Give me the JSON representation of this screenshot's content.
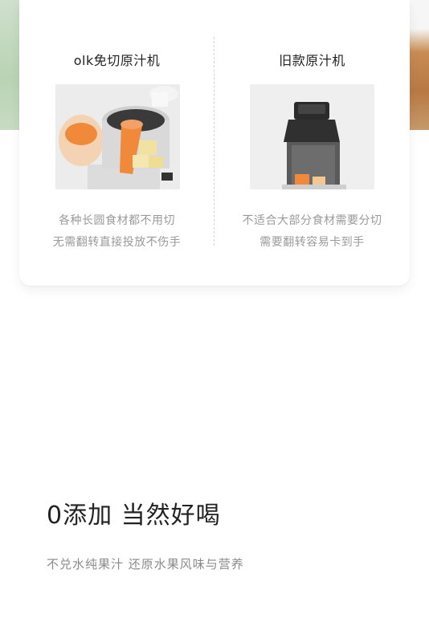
{
  "comparison": {
    "left": {
      "title": "olk免切原汁机",
      "image_label": "juicer-with-carrot-and-pineapple",
      "lines": [
        "各种长圆食材都不用切",
        "无需翻转直接投放不伤手"
      ]
    },
    "right": {
      "title": "旧款原汁机",
      "image_label": "old-juicer-with-narrow-chute",
      "lines": [
        "不适合大部分食材需要分切",
        "需要翻转容易卡到手"
      ]
    }
  },
  "feature": {
    "headline": "0添加 当然好喝",
    "subline": "不兑水纯果汁  还原水果风味与营养"
  },
  "colors": {
    "title": "#222222",
    "desc": "#9a9a9a",
    "carrot": "#f08a3a",
    "divider": "#d2d2d2"
  }
}
